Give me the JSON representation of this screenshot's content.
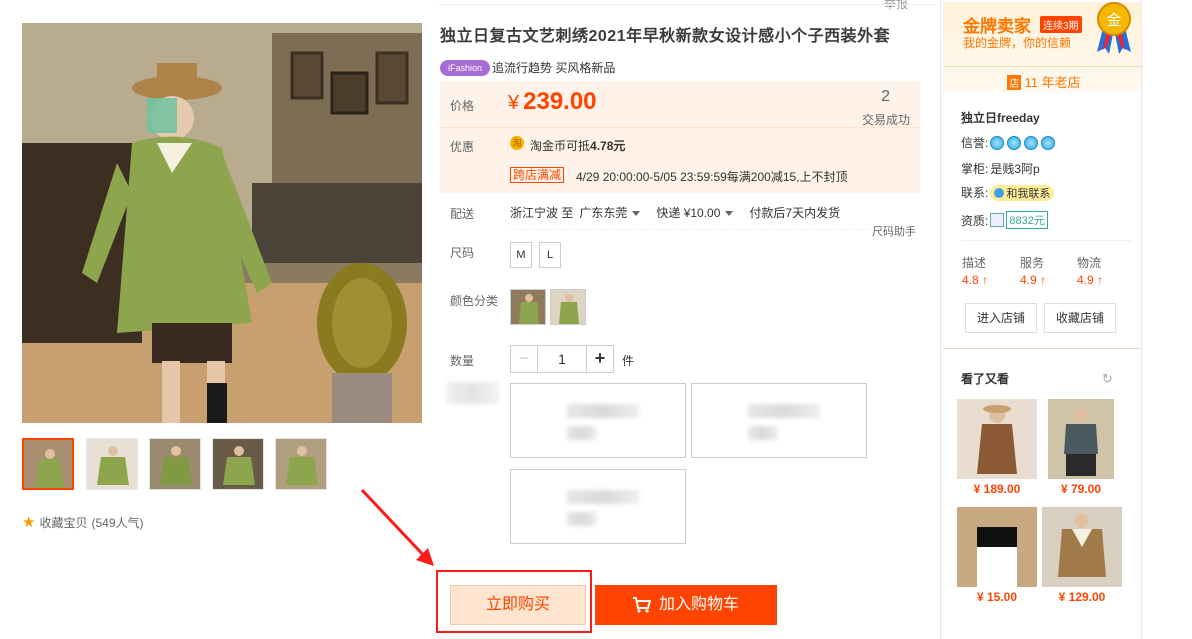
{
  "header": {
    "report_label": "举报"
  },
  "gallery": {
    "thumb_count": 5,
    "favorite_label": "收藏宝贝",
    "favorite_count": "(549人气)"
  },
  "product": {
    "title": "独立日复古文艺刺绣2021年早秋新款女设计感小个子西装外套",
    "tag_logo": "iFashion",
    "tag_text": "追流行趋势 买风格新品"
  },
  "price": {
    "label": "价格",
    "currency": "¥",
    "value": "239.00",
    "sold_count": "2",
    "sold_label": "交易成功"
  },
  "promo": {
    "label": "优惠",
    "coin_icon": "淘",
    "coin_text_prefix": "淘金币可抵",
    "coin_amount": "4.78元",
    "tag": "跨店满减",
    "detail": "4/29 20:00:00-5/05 23:59:59每满200减15,上不封顶"
  },
  "shipping": {
    "label": "配送",
    "from": "浙江宁波 至",
    "to": "广东东莞",
    "method": "快递 ¥10.00",
    "note": "付款后7天内发货",
    "size_helper": "尺码助手"
  },
  "size": {
    "label": "尺码",
    "options": [
      "M",
      "L"
    ]
  },
  "color": {
    "label": "颜色分类"
  },
  "quantity": {
    "label": "数量",
    "value": "1",
    "minus": "−",
    "plus": "+",
    "unit": "件"
  },
  "actions": {
    "buy_now": "立即购买",
    "add_cart": "加入购物车"
  },
  "seller": {
    "gold_title": "金牌卖家",
    "gold_badge": "连续3期",
    "gold_sub": "我的金牌，你的信赖",
    "medal_char": "金",
    "years_icon": "店",
    "years": "11 年老店",
    "shop_name": "独立日freeday",
    "credit_label": "信誉:",
    "keeper_label": "掌柜:",
    "keeper": "是贱3阿p",
    "contact_label": "联系:",
    "contact_btn": "和我联系",
    "qual_label": "资质:",
    "deposit": "8832元",
    "scores": [
      {
        "name": "描述",
        "value": "4.8"
      },
      {
        "name": "服务",
        "value": "4.9"
      },
      {
        "name": "物流",
        "value": "4.9"
      }
    ],
    "enter_shop": "进入店铺",
    "fav_shop": "收藏店铺"
  },
  "see_also": {
    "title": "看了又看",
    "items": [
      {
        "price": "¥ 189.00"
      },
      {
        "price": "¥ 79.00"
      },
      {
        "price": "¥ 15.00"
      },
      {
        "price": "¥ 129.00"
      }
    ]
  },
  "colors": {
    "accent": "#ff4400",
    "price_bg": "#fff2e8",
    "gold": "#ff7700"
  }
}
